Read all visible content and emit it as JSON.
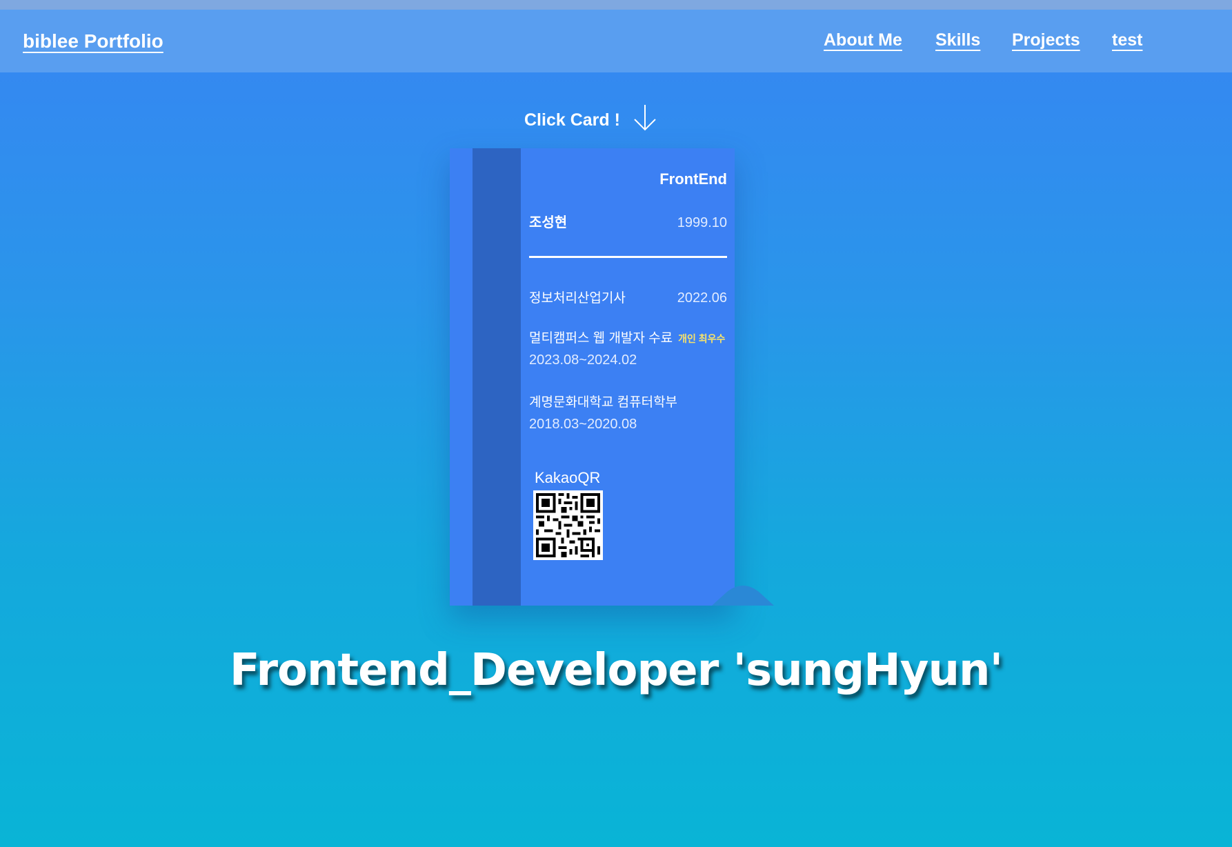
{
  "header": {
    "brand": "biblee Portfolio",
    "nav": [
      "About Me",
      "Skills",
      "Projects",
      "test"
    ]
  },
  "hint": {
    "text": "Click Card !",
    "icon": "arrow-down-icon"
  },
  "card": {
    "role": "FrontEnd",
    "name": "조성현",
    "birth": "1999.10",
    "entries": [
      {
        "title": "정보처리산업기사",
        "date": "2022.06"
      },
      {
        "title": "멀티캠퍼스 웹 개발자 수료",
        "badge": "개인 최우수",
        "period": "2023.08~2024.02"
      },
      {
        "title": "계명문화대학교 컴퓨터학부",
        "period": "2018.03~2020.08"
      }
    ],
    "qr_label": "KakaoQR",
    "qr_icon": "qr-code-icon"
  },
  "headline": "Frontend_Developer  'sungHyun'",
  "colors": {
    "navbar": "#599ef0",
    "card": "#3c80f3",
    "card_stripe": "#2d64c2",
    "badge": "#f7e36a"
  }
}
